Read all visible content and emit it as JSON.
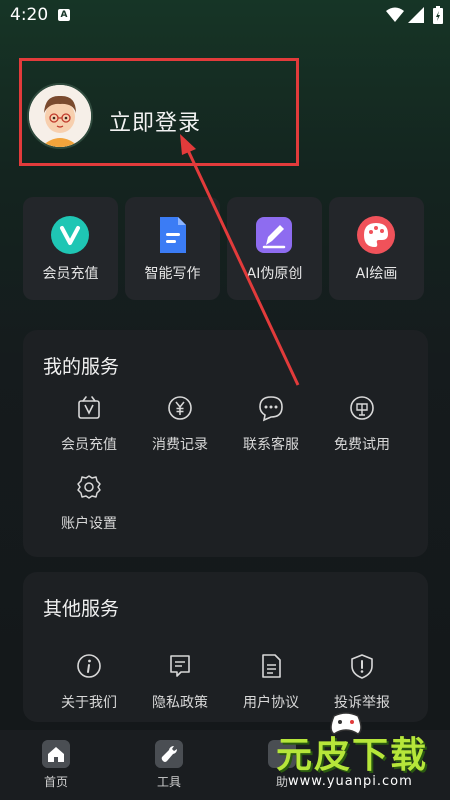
{
  "status_bar": {
    "time": "4:20",
    "badge": "A"
  },
  "profile": {
    "login_label": "立即登录"
  },
  "quick_actions": [
    {
      "label": "会员充值",
      "icon": "vip-v-icon",
      "color": "#1fc6b4"
    },
    {
      "label": "智能写作",
      "icon": "document-icon",
      "color": "#3b7cf5"
    },
    {
      "label": "AI伪原创",
      "icon": "pen-icon",
      "color": "#8e6cf0"
    },
    {
      "label": "AI绘画",
      "icon": "palette-icon",
      "color": "#f0525a"
    }
  ],
  "my_services": {
    "title": "我的服务",
    "items": [
      {
        "label": "会员充值",
        "icon": "vip-icon"
      },
      {
        "label": "消费记录",
        "icon": "yen-icon"
      },
      {
        "label": "联系客服",
        "icon": "chat-icon"
      },
      {
        "label": "免费试用",
        "icon": "free-icon"
      },
      {
        "label": "账户设置",
        "icon": "gear-icon"
      }
    ]
  },
  "other_services": {
    "title": "其他服务",
    "items": [
      {
        "label": "关于我们",
        "icon": "info-icon"
      },
      {
        "label": "隐私政策",
        "icon": "policy-icon"
      },
      {
        "label": "用户协议",
        "icon": "agreement-icon"
      },
      {
        "label": "投诉举报",
        "icon": "report-icon"
      }
    ]
  },
  "tabbar": [
    {
      "label": "首页",
      "icon": "home-icon"
    },
    {
      "label": "工具",
      "icon": "wrench-icon"
    },
    {
      "label": "助",
      "icon": "assistant-icon"
    }
  ],
  "watermark": {
    "title": "元皮下载",
    "url": "www.yuanpi.com"
  },
  "colors": {
    "highlight": "#e23b3b",
    "background": "#151b1d",
    "card": "#1d2023"
  }
}
